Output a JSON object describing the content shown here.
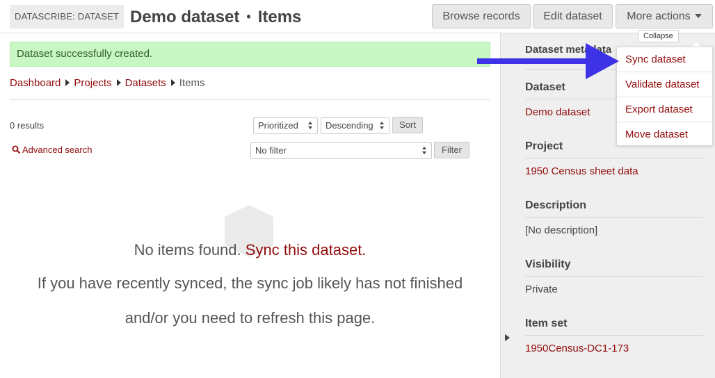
{
  "header": {
    "module_label": "DATASCRIBE: DATASET",
    "title": "Demo dataset",
    "separator": "•",
    "subtitle": "Items",
    "buttons": {
      "browse": "Browse records",
      "edit": "Edit dataset",
      "more": "More actions"
    }
  },
  "messages": {
    "success": "Dataset successfully created."
  },
  "breadcrumb": [
    "Dashboard",
    "Projects",
    "Datasets",
    "Items"
  ],
  "browse": {
    "results": "0 results",
    "sort_by": "Prioritized",
    "sort_order": "Descending",
    "sort_button": "Sort",
    "advanced_search": "Advanced search",
    "filter": "No filter",
    "filter_button": "Filter"
  },
  "empty": {
    "prefix": "No items found.",
    "link": "Sync this dataset.",
    "line2": "If you have recently synced, the sync job likely has not finished",
    "line3": "and/or you need to refresh this page."
  },
  "sidebar": {
    "header": "Dataset metadata",
    "dataset_label": "Dataset",
    "dataset_value": "Demo dataset",
    "project_label": "Project",
    "project_value": "1950 Census sheet data",
    "description_label": "Description",
    "description_value": "[No description]",
    "visibility_label": "Visibility",
    "visibility_value": "Private",
    "itemset_label": "Item set",
    "itemset_value": "1950Census-DC1-173"
  },
  "dropdown": {
    "tooltip": "Collapse",
    "items": [
      "Sync dataset",
      "Validate dataset",
      "Export dataset",
      "Move dataset"
    ]
  },
  "colors": {
    "link": "#920b0b",
    "success_bg": "#c9f7c4",
    "annotation_arrow": "#3d32e6"
  }
}
